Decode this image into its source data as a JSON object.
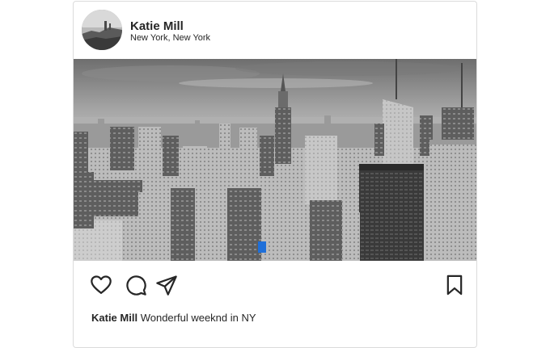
{
  "post": {
    "username": "Katie Mill",
    "location": "New York, New York",
    "caption_user": "Katie Mill",
    "caption_text": "Wonderful weeknd in NY"
  },
  "icons": {
    "like": "heart-icon",
    "comment": "comment-icon",
    "share": "paper-plane-icon",
    "save": "bookmark-icon"
  },
  "colors": {
    "text": "#262626",
    "border": "#dbdbdb",
    "highlight": "#1e6fd9"
  }
}
